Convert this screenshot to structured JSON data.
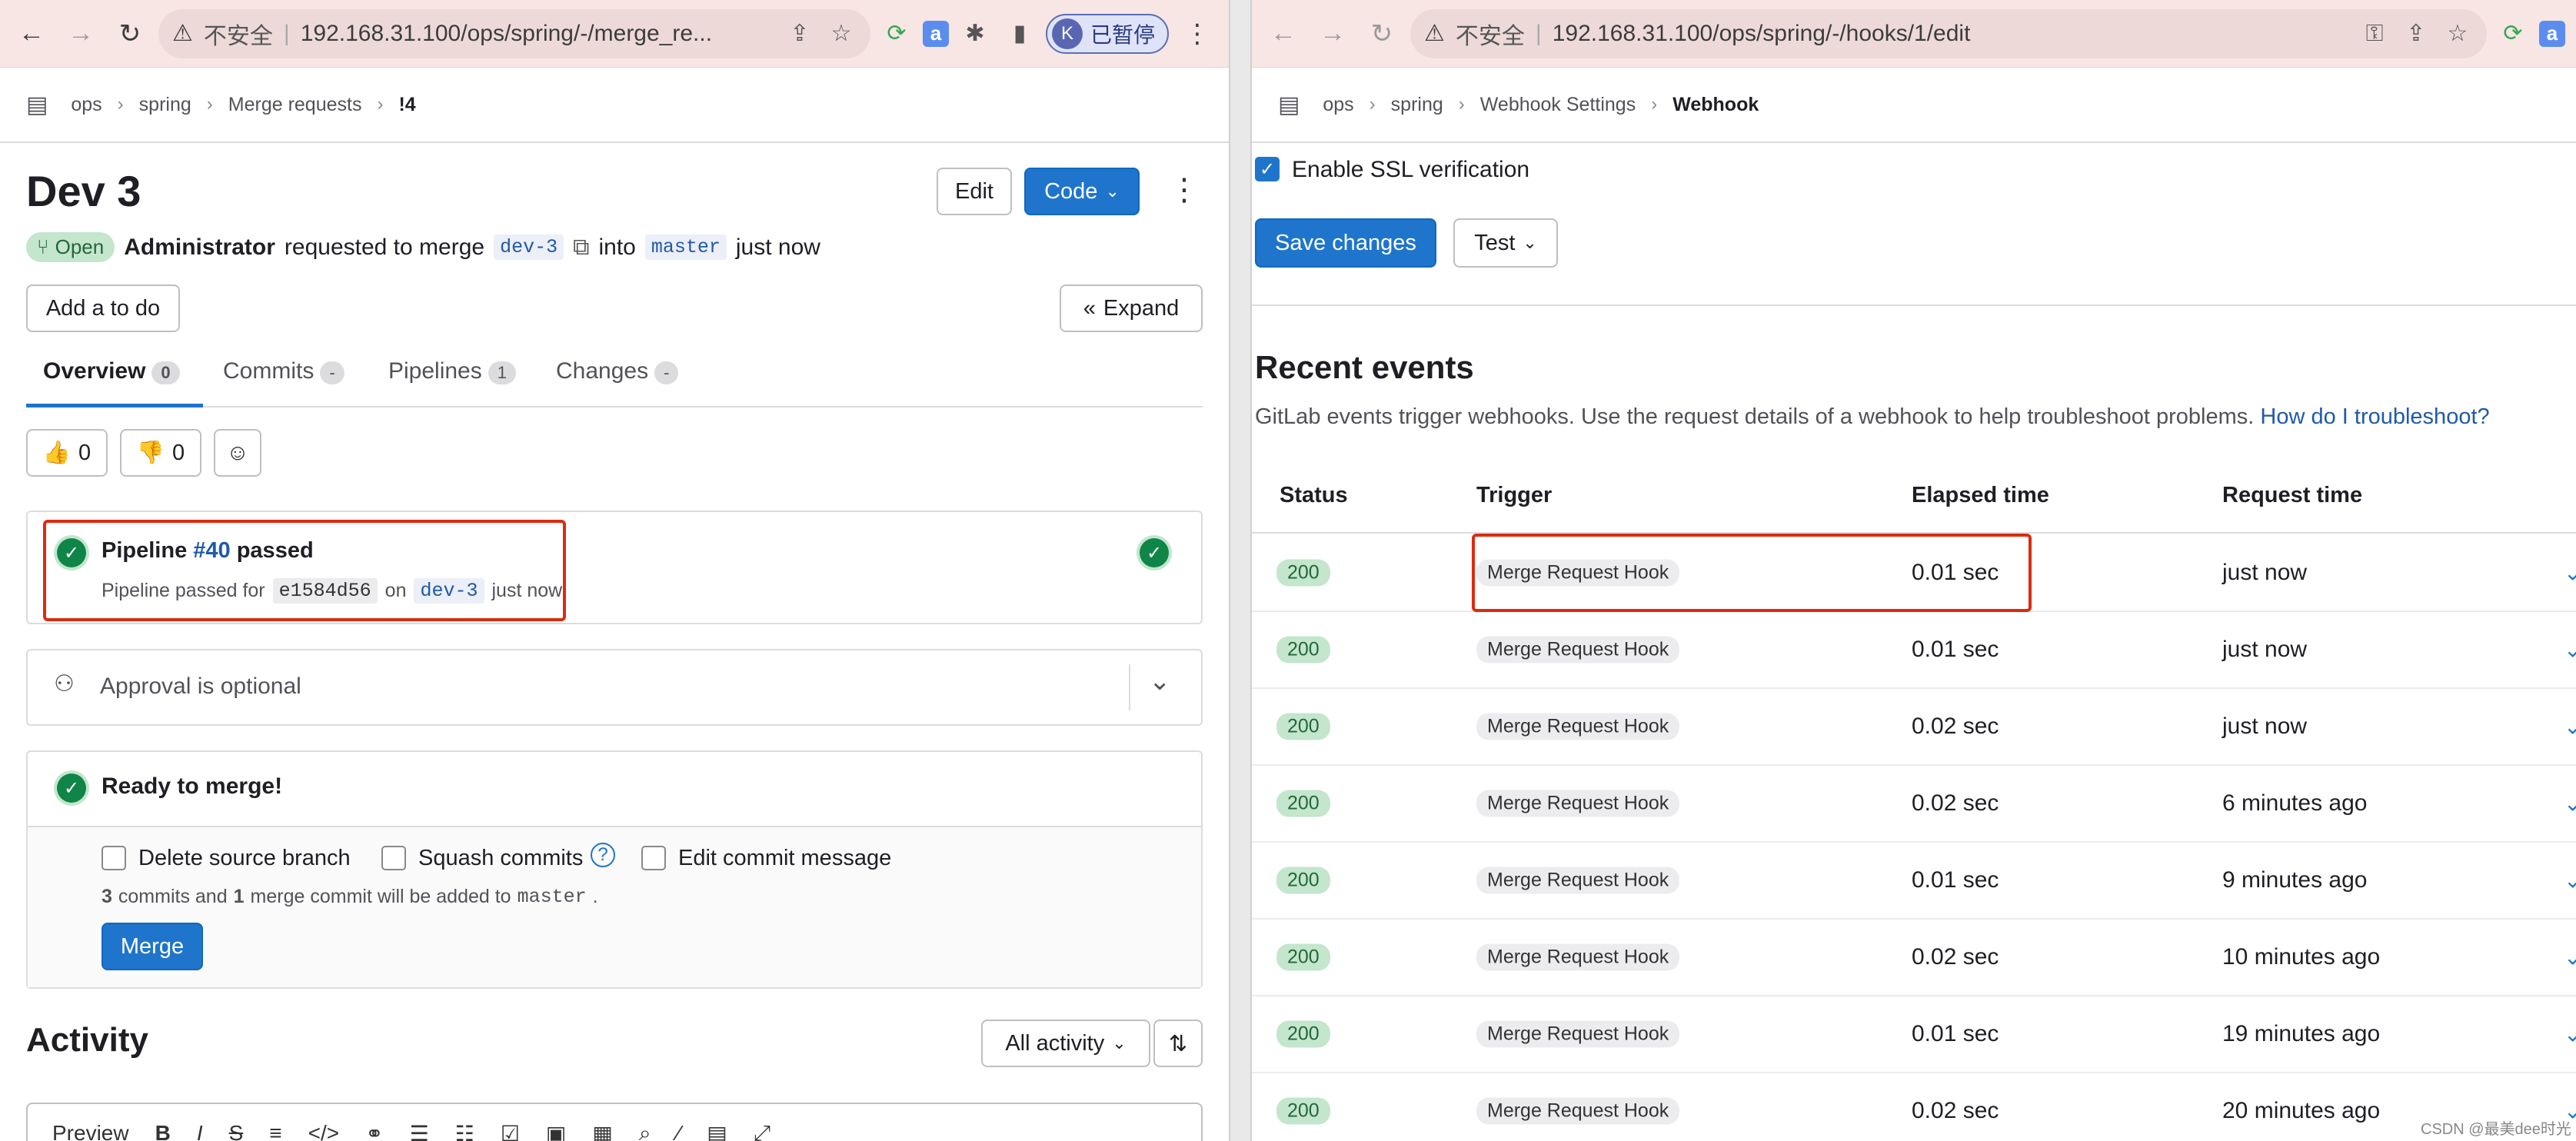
{
  "left": {
    "url": "192.168.31.100/ops/spring/-/merge_re...",
    "not_secure": "不安全",
    "profile_initial": "K",
    "profile_label": "已暂停",
    "breadcrumbs": [
      "ops",
      "spring",
      "Merge requests",
      "!4"
    ],
    "title": "Dev 3",
    "edit_label": "Edit",
    "code_label": "Code",
    "status": "Open",
    "author": "Administrator",
    "requested_text": "requested to merge",
    "source_branch": "dev-3",
    "into_text": "into",
    "target_branch": "master",
    "time": "just now",
    "todo_label": "Add a to do",
    "expand_label": "Expand",
    "tabs": [
      {
        "label": "Overview",
        "count": "0"
      },
      {
        "label": "Commits",
        "count": "-"
      },
      {
        "label": "Pipelines",
        "count": "1"
      },
      {
        "label": "Changes",
        "count": "-"
      }
    ],
    "thumbs_up": "0",
    "thumbs_down": "0",
    "pipeline": {
      "prefix": "Pipeline",
      "id": "#40",
      "suffix": "passed",
      "passed_for": "Pipeline passed for",
      "commit": "e1584d56",
      "on": "on",
      "branch": "dev-3",
      "time": "just now"
    },
    "approval": "Approval is optional",
    "ready": "Ready to merge!",
    "options": [
      "Delete source branch",
      "Squash commits",
      "Edit commit message"
    ],
    "commits_info": {
      "n1": "3",
      "t1": "commits and",
      "n2": "1",
      "t2": "merge commit will be added to",
      "branch": "master",
      "end": "."
    },
    "merge_label": "Merge",
    "activity_title": "Activity",
    "activity_filter": "All activity",
    "preview_label": "Preview",
    "editor_tools": [
      "B",
      "I",
      "S"
    ]
  },
  "right": {
    "url": "192.168.31.100/ops/spring/-/hooks/1/edit",
    "not_secure": "不安全",
    "breadcrumbs": [
      "ops",
      "spring",
      "Webhook Settings",
      "Webhook"
    ],
    "ssl_label": "Enable SSL verification",
    "save_label": "Save changes",
    "test_label": "Test",
    "recent_title": "Recent events",
    "recent_desc": "GitLab events trigger webhooks. Use the request details of a webhook to help troubleshoot problems.",
    "troubleshoot_link": "How do I troubleshoot?",
    "columns": [
      "Status",
      "Trigger",
      "Elapsed time",
      "Request time"
    ],
    "events": [
      {
        "status": "200",
        "trigger": "Merge Request Hook",
        "elapsed": "0.01 sec",
        "time": "just now"
      },
      {
        "status": "200",
        "trigger": "Merge Request Hook",
        "elapsed": "0.01 sec",
        "time": "just now"
      },
      {
        "status": "200",
        "trigger": "Merge Request Hook",
        "elapsed": "0.02 sec",
        "time": "just now"
      },
      {
        "status": "200",
        "trigger": "Merge Request Hook",
        "elapsed": "0.02 sec",
        "time": "6 minutes ago"
      },
      {
        "status": "200",
        "trigger": "Merge Request Hook",
        "elapsed": "0.01 sec",
        "time": "9 minutes ago"
      },
      {
        "status": "200",
        "trigger": "Merge Request Hook",
        "elapsed": "0.02 sec",
        "time": "10 minutes ago"
      },
      {
        "status": "200",
        "trigger": "Merge Request Hook",
        "elapsed": "0.01 sec",
        "time": "19 minutes ago"
      },
      {
        "status": "200",
        "trigger": "Merge Request Hook",
        "elapsed": "0.02 sec",
        "time": "20 minutes ago"
      }
    ],
    "watermark": "CSDN @最美dee时光"
  }
}
